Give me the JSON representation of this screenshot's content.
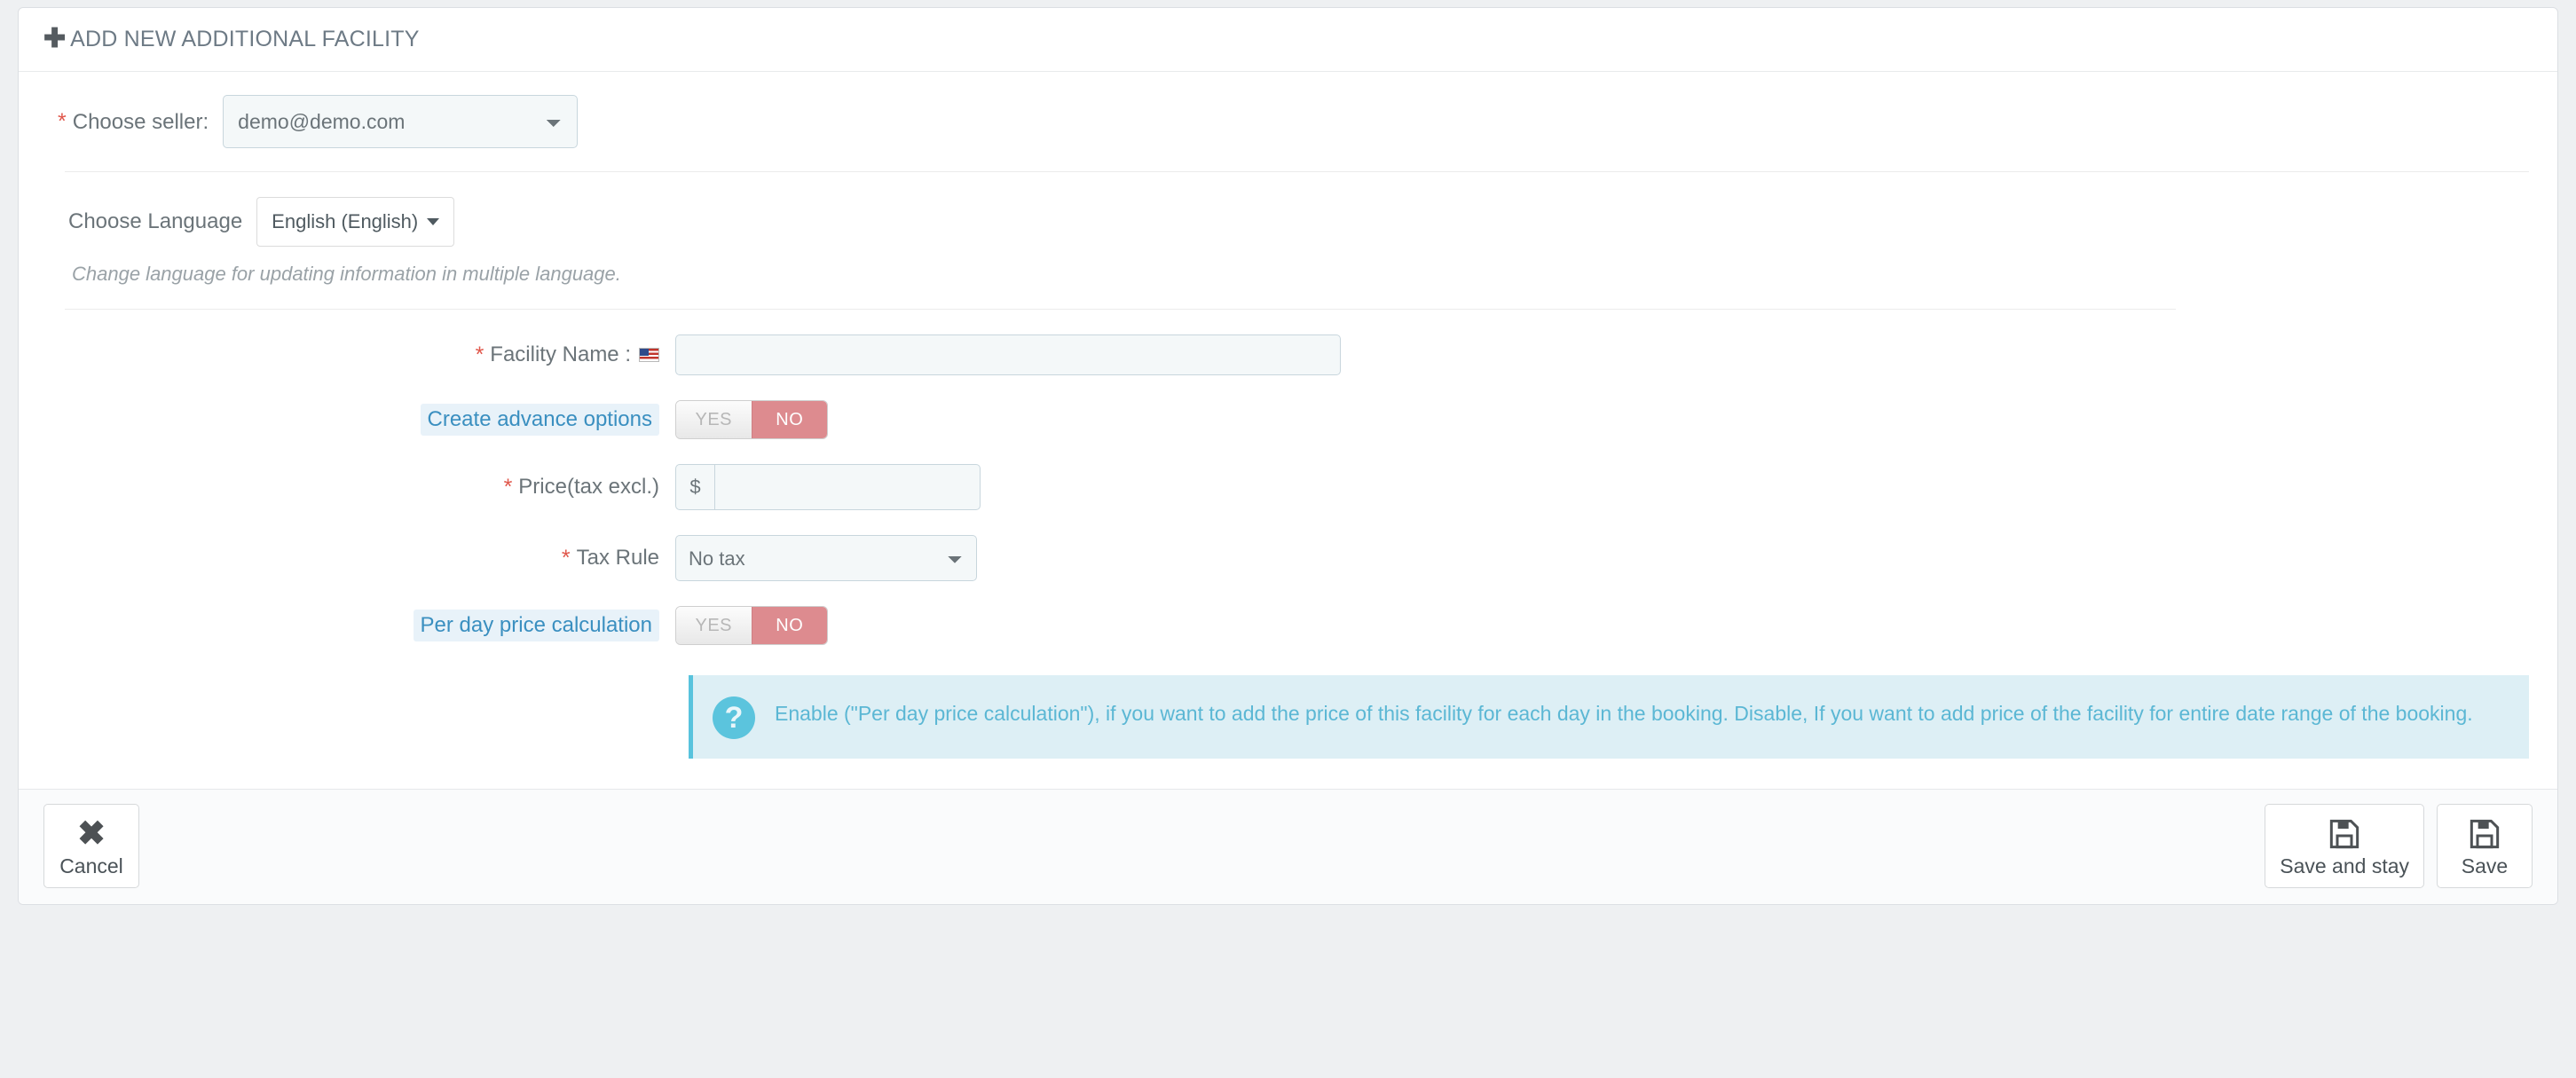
{
  "header": {
    "plus_icon": "plus-icon",
    "title": "ADD NEW ADDITIONAL FACILITY"
  },
  "seller": {
    "required_mark": "*",
    "label": "Choose seller:",
    "value": "demo@demo.com",
    "options": [
      "demo@demo.com"
    ]
  },
  "language": {
    "label": "Choose Language",
    "value": "English (English)",
    "hint": "Change language for updating information in multiple language."
  },
  "fields": {
    "facility_name": {
      "required_mark": "*",
      "label": "Facility Name :",
      "flag_icon": "us-flag-icon",
      "value": "",
      "placeholder": ""
    },
    "create_advance_options": {
      "label": "Create advance options",
      "yes_label": "YES",
      "no_label": "NO",
      "selected": "NO"
    },
    "price": {
      "required_mark": "*",
      "label": "Price(tax excl.)",
      "currency_symbol": "$",
      "value": "",
      "placeholder": ""
    },
    "tax_rule": {
      "required_mark": "*",
      "label": "Tax Rule",
      "value": "No tax",
      "options": [
        "No tax"
      ]
    },
    "per_day_price_calculation": {
      "label": "Per day price calculation",
      "yes_label": "YES",
      "no_label": "NO",
      "selected": "NO"
    }
  },
  "info_alert": {
    "icon": "question-mark-icon",
    "text": "Enable (\"Per day price calculation\"), if you want to add the price of this facility for each day in the booking. Disable, If you want to add price of the facility for entire date range of the booking."
  },
  "footer": {
    "cancel": {
      "label": "Cancel",
      "icon": "close-x-icon"
    },
    "save_and_stay": {
      "label": "Save and stay",
      "icon": "floppy-disk-icon"
    },
    "save": {
      "label": "Save",
      "icon": "floppy-disk-icon"
    }
  },
  "colors": {
    "accent_link": "#3a8fc0",
    "required": "#e0574b",
    "toggle_no": "#dd8b8f",
    "info_border": "#58c3dd",
    "info_bg": "#ddeff5"
  }
}
